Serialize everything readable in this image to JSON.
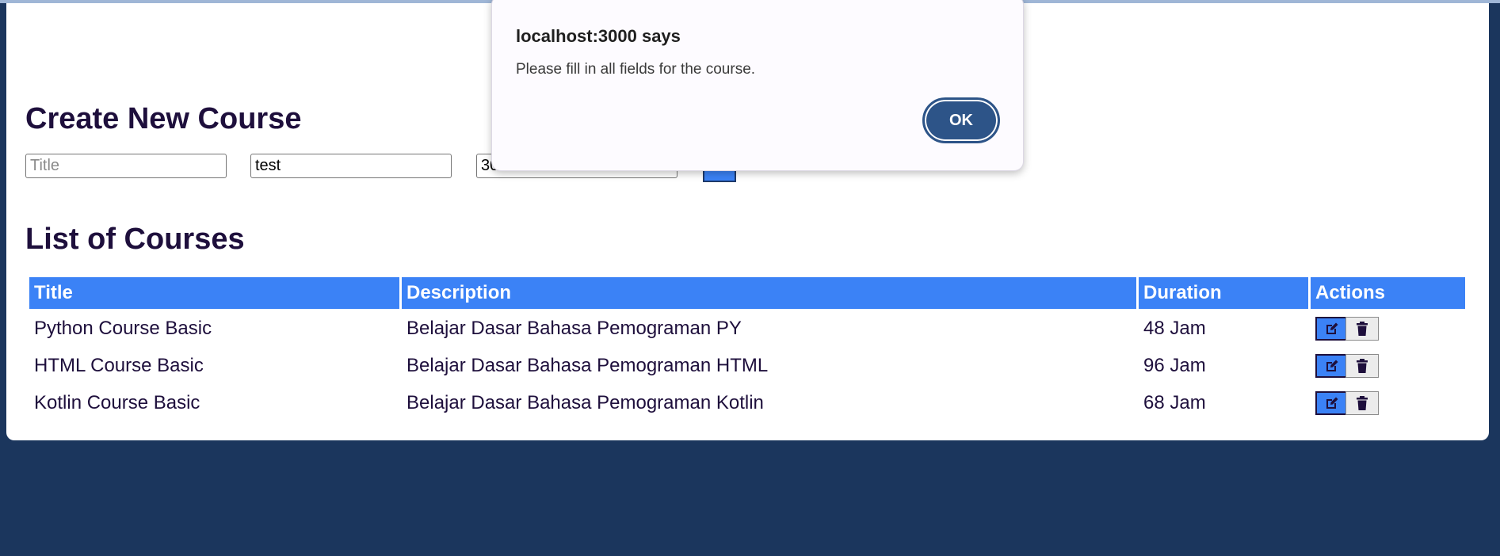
{
  "page": {
    "create_heading": "Create New Course",
    "list_heading": "List of Courses"
  },
  "form": {
    "title_placeholder": "Title",
    "title_value": "",
    "description_value": "test",
    "duration_value": "30 Jam"
  },
  "table": {
    "headers": [
      "Title",
      "Description",
      "Duration",
      "Actions"
    ],
    "rows": [
      {
        "title": "Python Course Basic",
        "description": "Belajar Dasar Bahasa Pemograman PY",
        "duration": "48 Jam"
      },
      {
        "title": "HTML Course Basic",
        "description": "Belajar Dasar Bahasa Pemograman HTML",
        "duration": "96 Jam"
      },
      {
        "title": "Kotlin Course Basic",
        "description": "Belajar Dasar Bahasa Pemograman Kotlin",
        "duration": "68 Jam"
      }
    ],
    "action_icons": [
      "edit-icon",
      "trash-icon"
    ]
  },
  "dialog": {
    "title": "localhost:3000 says",
    "message": "Please fill in all fields for the course.",
    "ok_label": "OK"
  },
  "colors": {
    "page_background": "#1b365d",
    "accent": "#3b82f6",
    "heading_text": "#1e0f3c",
    "dialog_button": "#2d5488"
  }
}
